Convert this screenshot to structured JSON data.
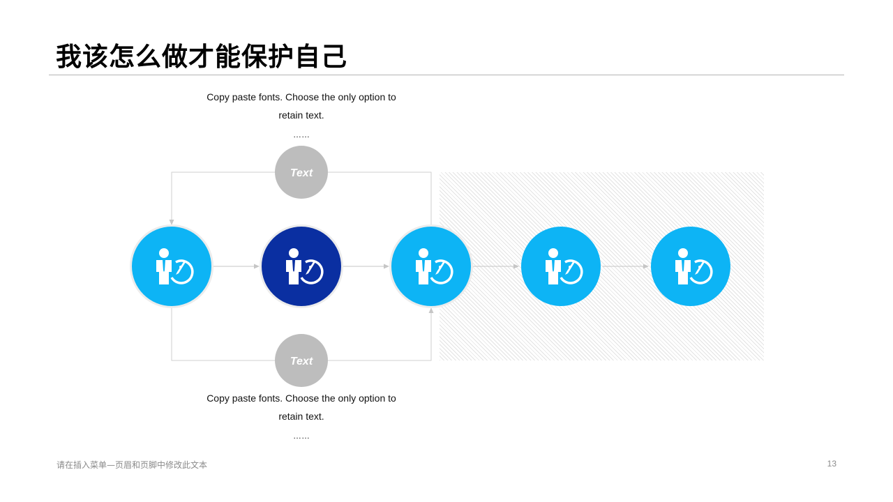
{
  "title": "我该怎么做才能保护自己",
  "notes": {
    "top": {
      "line1": "Copy paste fonts. Choose the only option to",
      "line2": "retain text.",
      "line3": "……"
    },
    "bottom": {
      "line1": "Copy paste fonts. Choose the only option to",
      "line2": "retain text.",
      "line3": "……"
    }
  },
  "gray_nodes": {
    "top_label": "Text",
    "bottom_label": "Text"
  },
  "icon": "businessman-with-compass-icon",
  "colors": {
    "light_blue": "#0db4f5",
    "dark_blue": "#0a2fa1",
    "gray": "#bdbdbd",
    "connector": "#c6c6c6"
  },
  "footer": {
    "text": "请在插入菜单—页眉和页脚中修改此文本",
    "page_number": "13"
  }
}
